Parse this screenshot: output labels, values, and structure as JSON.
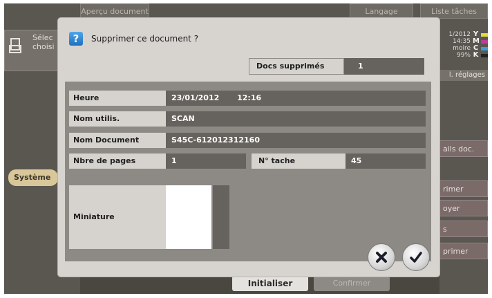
{
  "background": {
    "top_left_tab": "Aperçu document",
    "top_language_tab": "Langage",
    "top_right_tab": "Liste tâches",
    "left_panel_text_line1": "Sélec",
    "left_panel_text_line2": "choisi",
    "system_tab": "Système",
    "status": {
      "date": "1/2012",
      "time": "14:35",
      "toner_word": "moire",
      "percent": "99%",
      "toner_letters": [
        "Y",
        "M",
        "C",
        "K"
      ],
      "toner_colors": [
        "#e6d93a",
        "#c23a9a",
        "#3aa0d8",
        "#222222"
      ]
    },
    "reglages_label": "l. réglages",
    "right_buttons": [
      "ails doc.",
      "rimer",
      "oyer",
      "s",
      "primer"
    ],
    "bottom_buttons": {
      "initialiser": "Initialiser",
      "confirm": "Confirmer"
    }
  },
  "dialog": {
    "title": "Supprimer ce document ?",
    "deleted_label": "Docs supprimés",
    "deleted_value": "1",
    "fields": {
      "time_label": "Heure",
      "time_value": "23/01/2012",
      "time_value2": "12:16",
      "user_label": "Nom utilis.",
      "user_value": "SCAN",
      "doc_name_label": "Nom Document",
      "doc_name_value": "S45C-612012312160",
      "pages_label": "Nbre de pages",
      "pages_value": "1",
      "job_label": "N° tache",
      "job_value": "45",
      "thumbnail_label": "Miniature"
    }
  },
  "colors": {
    "dialog_bg": "#d7d4d0",
    "value_bg": "#66625d",
    "panel_bg": "#8d8984"
  }
}
